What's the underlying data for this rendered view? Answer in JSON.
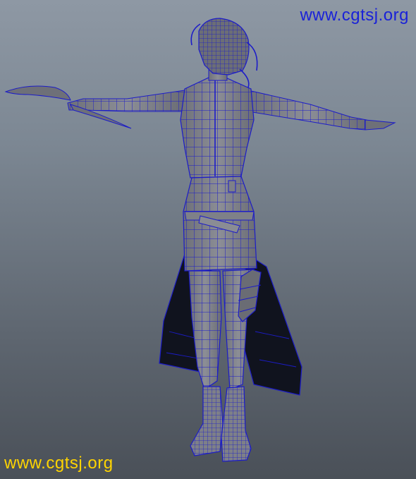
{
  "watermarks": {
    "top_right": "www.cgtsj.org",
    "bottom_left": "www.cgtsj.org"
  },
  "scene": {
    "subject_icon": "wireframe-character-model-icon",
    "colors": {
      "background_top": "#8e98a4",
      "background_bottom": "#4a5058",
      "mesh_fill": "#7e8088",
      "wire": "#1c1cc8",
      "coat_fill": "#10131e",
      "top_watermark": "#1a22d8",
      "bottom_watermark": "#ffd400"
    }
  }
}
